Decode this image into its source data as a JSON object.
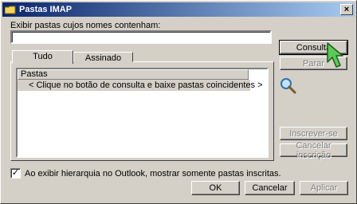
{
  "window": {
    "title": "Pastas IMAP",
    "close_glyph": "×"
  },
  "filter": {
    "label": "Exibir pastas cujos nomes contenham:",
    "value": "",
    "placeholder": ""
  },
  "tabs": [
    {
      "label": "Tudo"
    },
    {
      "label": "Assinado"
    }
  ],
  "list": {
    "column_header": "Pastas",
    "items": [
      {
        "label": "< Clique no botão de consulta e baixe pastas coincidentes >"
      }
    ]
  },
  "side_buttons": {
    "query": "Consulta",
    "stop": "Parar",
    "subscribe": "Inscrever-se",
    "unsubscribe": "Cancelar inscrição"
  },
  "checkbox": {
    "checked": true,
    "glyph": "✓",
    "label": "Ao exibir hierarquia no Outlook, mostrar somente pastas inscritas."
  },
  "footer_buttons": {
    "ok": "OK",
    "cancel": "Cancelar",
    "apply": "Aplicar"
  },
  "icons": {
    "title": "folder-icon",
    "search": "magnifier-icon",
    "cursor": "pointer-cursor-icon"
  },
  "colors": {
    "titlebar_start": "#0a246a",
    "titlebar_end": "#a6caf0",
    "face": "#d4d0c8",
    "cursor_green": "#4caf50"
  }
}
